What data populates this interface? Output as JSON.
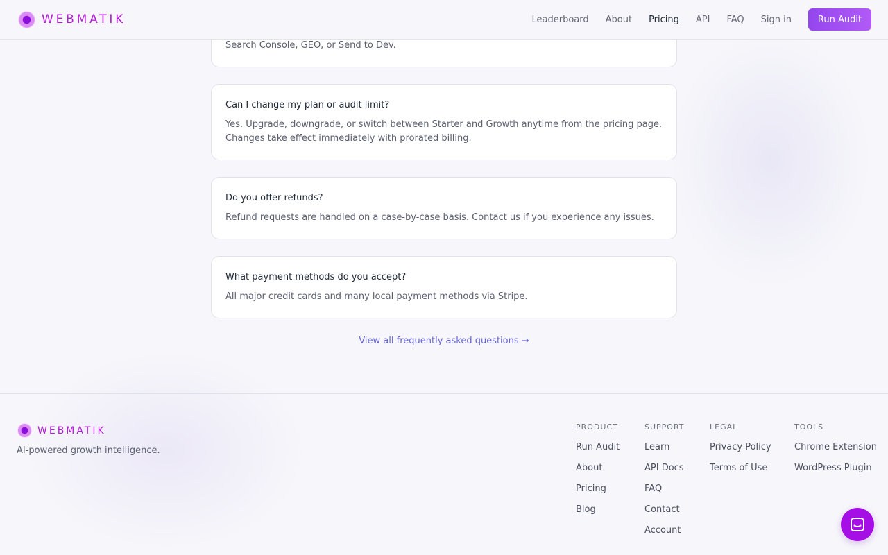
{
  "brand": {
    "name": "WEBMATIK",
    "tagline": "AI-powered growth intelligence.",
    "accent_color": "#b21ed2",
    "cta_color": "#9e50f2"
  },
  "nav": {
    "items": [
      {
        "label": "Leaderboard"
      },
      {
        "label": "About"
      },
      {
        "label": "Pricing",
        "active": true
      },
      {
        "label": "API"
      },
      {
        "label": "FAQ"
      },
      {
        "label": "Sign in"
      }
    ],
    "cta_label": "Run Audit"
  },
  "faq": {
    "partial_answer": "Search Console, GEO, or Send to Dev.",
    "items": [
      {
        "question": "Can I change my plan or audit limit?",
        "answer_lines": [
          "Yes. Upgrade, downgrade, or switch between Starter and Growth anytime from the pricing page.",
          "Changes take effect immediately with prorated billing."
        ]
      },
      {
        "question": "Do you offer refunds?",
        "answer_lines": [
          "Refund requests are handled on a case-by-case basis. Contact us if you experience any issues."
        ]
      },
      {
        "question": "What payment methods do you accept?",
        "answer_lines": [
          "All major credit cards and many local payment methods via Stripe."
        ]
      }
    ],
    "view_all_label": "View all frequently asked questions →"
  },
  "footer": {
    "columns": [
      {
        "heading": "PRODUCT",
        "links": [
          "Run Audit",
          "About",
          "Pricing",
          "Blog"
        ]
      },
      {
        "heading": "SUPPORT",
        "links": [
          "Learn",
          "API Docs",
          "FAQ",
          "Contact",
          "Account"
        ]
      },
      {
        "heading": "LEGAL",
        "links": [
          "Privacy Policy",
          "Terms of Use"
        ]
      },
      {
        "heading": "TOOLS",
        "links": [
          "Chrome Extension",
          "WordPress Plugin"
        ]
      }
    ]
  },
  "chat": {
    "icon": "chat-bubble-icon",
    "color": "#a50ee4"
  }
}
